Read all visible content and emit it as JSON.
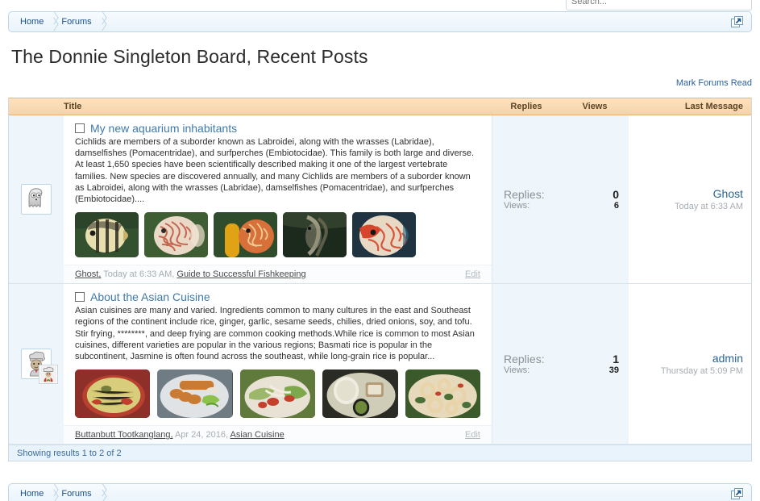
{
  "search": {
    "placeholder": "Search...",
    "value": ""
  },
  "breadcrumb": {
    "items": [
      {
        "label": "Home"
      },
      {
        "label": "Forums"
      }
    ],
    "popup_icon": "open-in-new-window-icon"
  },
  "header": {
    "page_title": "The Donnie Singleton Board, Recent Posts",
    "mark_forums_read": "Mark Forums Read"
  },
  "table": {
    "columns": {
      "title": "Title",
      "replies": "Replies",
      "views": "Views",
      "last_message": "Last Message"
    },
    "footer_status": "Showing results 1 to 2 of 2",
    "rows": [
      {
        "avatar": {
          "icon": "ghost-avatar-icon",
          "badge": null
        },
        "checkbox_checked": false,
        "title": "My new aquarium inhabitants",
        "snippet": "Cichlids are members of a suborder known as Labroidei, along with the wrasses (Labridae), damselfishes (Pomacentridae), and surfperches (Embiotocidae). This family is both large and diverse. At least 1,650 species have been scientifically described making it one of the largest vertebrate families. New species are discovered annually, and many Cichlids are members of a suborder known as Labroidei, along with the wrasses (Labridae), damselfishes (Pomacentridae), and surfperches (Embiotocidae)....",
        "thumbnails": [
          {
            "name": "angelfish-striped-thumbnail",
            "palette": [
              "#33502f",
              "#e8dfae",
              "#2c2a22",
              "#c9b36a"
            ]
          },
          {
            "name": "discus-fish-pale-thumbnail",
            "palette": [
              "#3f5d33",
              "#e9d9c6",
              "#c0503a",
              "#efe2d2"
            ]
          },
          {
            "name": "discus-fish-yellow-coral-thumbnail",
            "palette": [
              "#2f4d2c",
              "#e0a316",
              "#d8703a",
              "#e6c98a"
            ]
          },
          {
            "name": "angelfish-dark-thumbnail",
            "palette": [
              "#1c2a1e",
              "#6f6a54",
              "#b9b39a",
              "#30402c"
            ]
          },
          {
            "name": "discus-fish-red-blue-thumbnail",
            "palette": [
              "#1f3340",
              "#d6452c",
              "#e7d9c3",
              "#2f6d84"
            ]
          }
        ],
        "replies_label": "Replies:",
        "replies_value": "0",
        "views_label": "Views:",
        "views_value": "6",
        "last_user": "Ghost",
        "last_date": "Today at 6:33 AM",
        "meta_author": "Ghost,",
        "meta_date": "Today at 6:33 AM,",
        "meta_forum": "Guide to Successful Fishkeeping",
        "meta_edit": "Edit"
      },
      {
        "avatar": {
          "icon": "chef-avatar-icon",
          "badge": "chef-badge-icon"
        },
        "checkbox_checked": false,
        "title": "About the Asian Cuisine",
        "snippet": "Asian cuisines are many and varied. Ingredients common to many cultures in the east and Southeast regions of the continent include rice, ginger, garlic, sesame seeds, chilies, dried onions, soy, and tofu. Stir frying, ********, and deep frying are common cooking methods.While rice is common to most Asian cuisines, different varieties are popular in the various regions; Basmati rice is popular in the subcontinent, Jasmine is often found across the southeast, while long-grain rice is popular...",
        "thumbnails": [
          {
            "name": "papaya-salad-thumbnail",
            "palette": [
              "#8e2f2a",
              "#d8cd7a",
              "#c3412c",
              "#e8dfa8"
            ]
          },
          {
            "name": "grilled-sausage-plate-thumbnail",
            "palette": [
              "#b8bfc4",
              "#c97a33",
              "#8cc24a",
              "#e0e3e6"
            ]
          },
          {
            "name": "seafood-salad-thumbnail",
            "palette": [
              "#5f7a3a",
              "#e8e2d4",
              "#c4402c",
              "#9bb86a"
            ]
          },
          {
            "name": "coconut-dessert-bowls-thumbnail",
            "palette": [
              "#cfcdb8",
              "#e8e4d4",
              "#6f7a4a",
              "#9a8f72"
            ]
          },
          {
            "name": "calamari-stirfry-thumbnail",
            "palette": [
              "#3b5a2c",
              "#e6d9bc",
              "#c2432c",
              "#d9c9a4"
            ]
          }
        ],
        "replies_label": "Replies:",
        "replies_value": "1",
        "views_label": "Views:",
        "views_value": "39",
        "last_user": "admin",
        "last_date": "Thursday at 5:09 PM",
        "meta_author": "Buttanbutt Tootkanglang,",
        "meta_date": "Apr 24, 2016,",
        "meta_forum": "Asian Cuisine",
        "meta_edit": "Edit"
      }
    ]
  },
  "bottom_breadcrumb": {
    "items": [
      {
        "label": "Home"
      },
      {
        "label": "Forums"
      }
    ],
    "popup_icon": "open-in-new-window-icon"
  },
  "colors": {
    "header_orange": "#f7d3a6",
    "link_blue": "#3f7aab",
    "panel_blue": "#eef5fb",
    "footer_blue": "#e9f3fb"
  }
}
